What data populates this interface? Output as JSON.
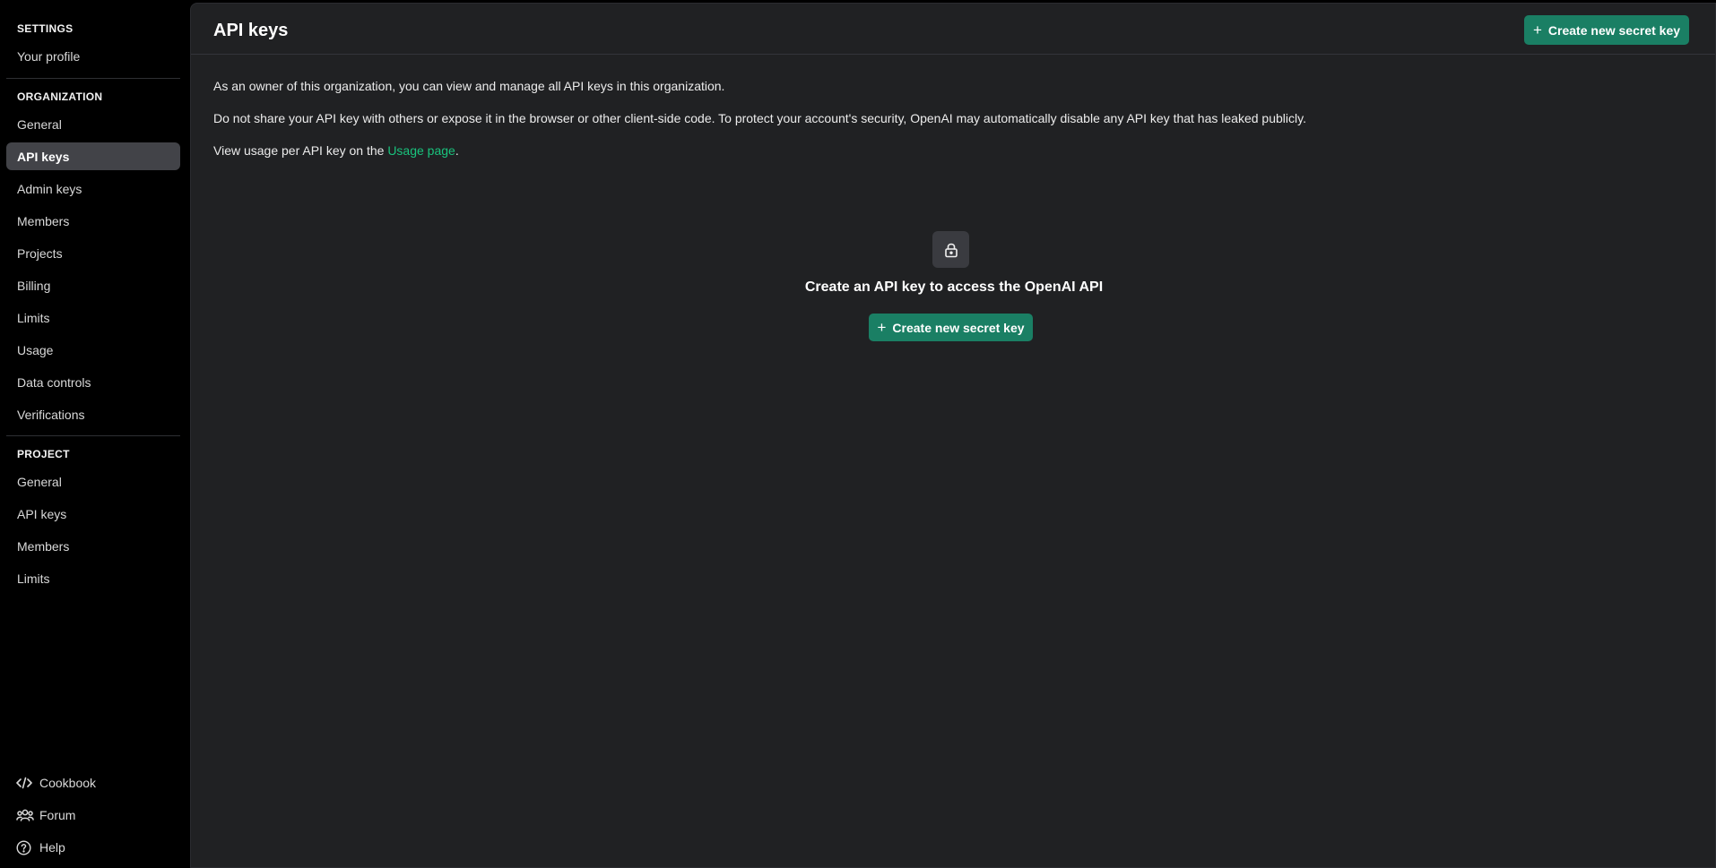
{
  "sidebar": {
    "settings_heading": "SETTINGS",
    "your_profile": "Your profile",
    "organization_heading": "ORGANIZATION",
    "org_items": [
      "General",
      "API keys",
      "Admin keys",
      "Members",
      "Projects",
      "Billing",
      "Limits",
      "Usage",
      "Data controls",
      "Verifications"
    ],
    "project_heading": "PROJECT",
    "project_items": [
      "General",
      "API keys",
      "Members",
      "Limits"
    ],
    "footer": {
      "cookbook": "Cookbook",
      "forum": "Forum",
      "help": "Help"
    }
  },
  "main": {
    "title": "API keys",
    "create_button": "Create new secret key",
    "para1": "As an owner of this organization, you can view and manage all API keys in this organization.",
    "para2": "Do not share your API key with others or expose it in the browser or other client-side code. To protect your account's security, OpenAI may automatically disable any API key that has leaked publicly.",
    "para3_prefix": "View usage per API key on the ",
    "para3_link": "Usage page",
    "para3_suffix": ".",
    "empty_title": "Create an API key to access the OpenAI API",
    "empty_button": "Create new secret key"
  },
  "icons": {
    "lock": "lock-icon",
    "plus": "plus-icon",
    "cookbook": "code-icon",
    "forum": "users-icon",
    "help": "question-circle-icon"
  },
  "colors": {
    "accent": "#1a7f64",
    "link": "#19c37d",
    "active_nav": "#424348",
    "panel": "#202123"
  }
}
